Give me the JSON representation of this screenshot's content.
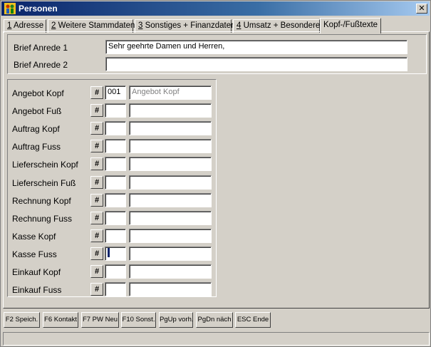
{
  "window": {
    "title": "Personen"
  },
  "tabs": [
    {
      "key": "1",
      "label": " Adresse"
    },
    {
      "key": "2",
      "label": " Weitere Stammdaten"
    },
    {
      "key": "3",
      "label": " Sonstiges + Finanzdaten"
    },
    {
      "key": "4",
      "label": " Umsatz + Besonderes"
    },
    {
      "key": "",
      "label": "Kopf-/Fußtexte"
    }
  ],
  "brief": {
    "anrede1_label": "Brief Anrede 1",
    "anrede1_value": "Sehr geehrte Damen und Herren,",
    "anrede2_label": "Brief Anrede 2",
    "anrede2_value": ""
  },
  "text_rows": [
    {
      "label": "Angebot Kopf",
      "button": "#",
      "code": "001",
      "text": "Angebot Kopf"
    },
    {
      "label": "Angebot Fuß",
      "button": "#",
      "code": "",
      "text": ""
    },
    {
      "label": "Auftrag Kopf",
      "button": "#",
      "code": "",
      "text": ""
    },
    {
      "label": "Auftrag Fuss",
      "button": "#",
      "code": "",
      "text": ""
    },
    {
      "label": "Lieferschein Kopf",
      "button": "#",
      "code": "",
      "text": ""
    },
    {
      "label": "Lieferschein Fuß",
      "button": "#",
      "code": "",
      "text": ""
    },
    {
      "label": "Rechnung Kopf",
      "button": "#",
      "code": "",
      "text": ""
    },
    {
      "label": "Rechnung Fuss",
      "button": "#",
      "code": "",
      "text": ""
    },
    {
      "label": "Kasse Kopf",
      "button": "#",
      "code": "",
      "text": ""
    },
    {
      "label": "Kasse Fuss",
      "button": "#",
      "code": "",
      "text": ""
    },
    {
      "label": "Einkauf Kopf",
      "button": "#",
      "code": "",
      "text": ""
    },
    {
      "label": "Einkauf Fuss",
      "button": "#",
      "code": "",
      "text": ""
    }
  ],
  "fkeys": [
    "F2 Speich.",
    "F6 Kontakt",
    "F7 PW Neu",
    "F10 Sonst.",
    "PgUp vorh.",
    "PgDn näch",
    "ESC Ende"
  ],
  "colors": {
    "titlebar_start": "#0a246a",
    "titlebar_end": "#a6caf0",
    "face": "#d4d0c8"
  },
  "icons": {
    "app": "people-icon",
    "close": "close-icon"
  }
}
